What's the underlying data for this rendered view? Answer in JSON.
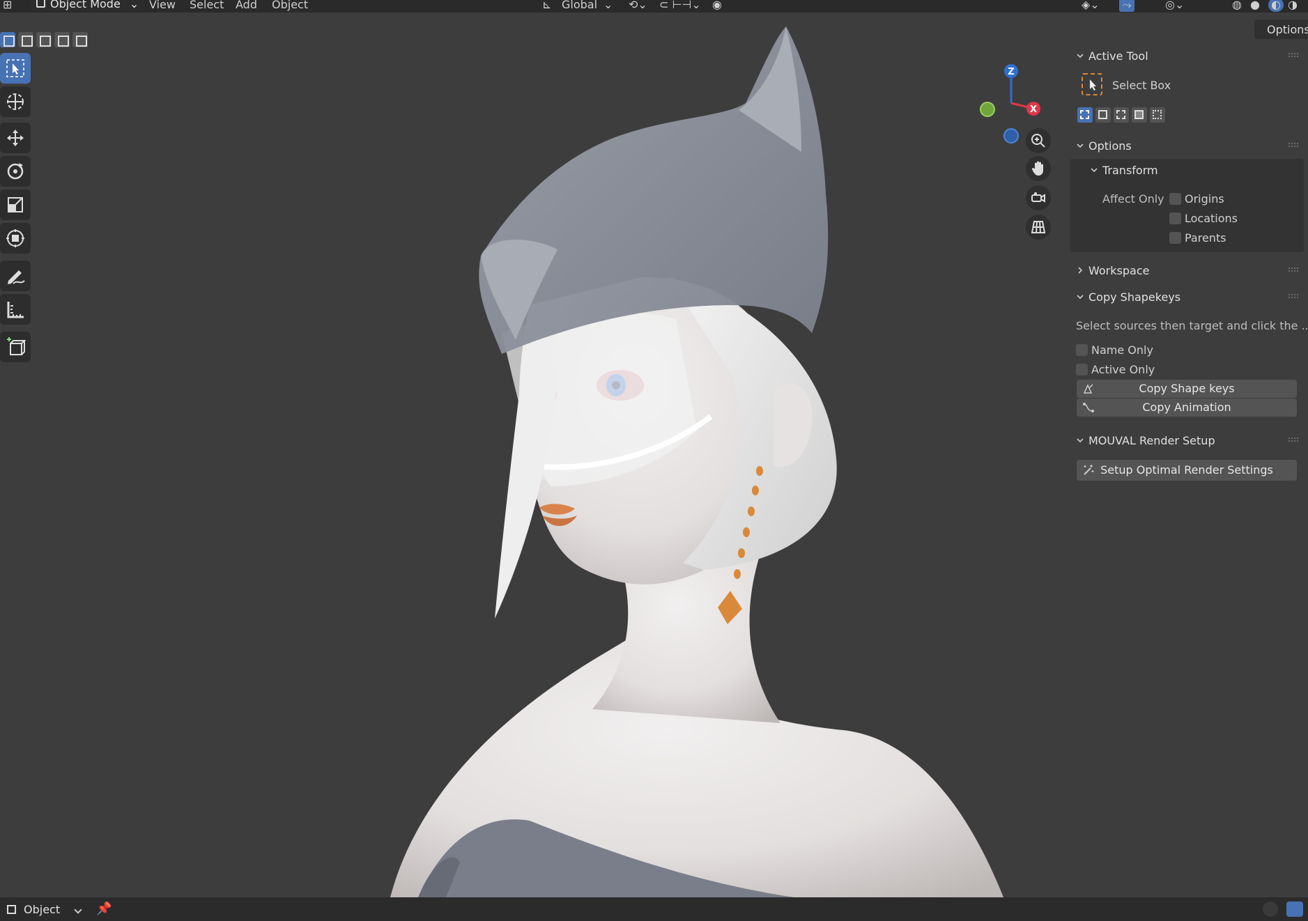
{
  "header": {
    "mode": "Object Mode",
    "menus": [
      "View",
      "Select",
      "Add",
      "Object"
    ],
    "orientation": "Global"
  },
  "options_tab": "Options",
  "toolbar": {
    "tools": [
      "select-box",
      "cursor",
      "move",
      "rotate",
      "scale",
      "transform",
      "annotate",
      "measure",
      "add-cube"
    ],
    "active_tool": "select-box"
  },
  "gizmo": {
    "axes": [
      "Z",
      "X"
    ],
    "colors": {
      "z": "#2f6fd0",
      "x": "#e0364a",
      "y": "#6fa53a"
    }
  },
  "panel": {
    "active_tool": {
      "title": "Active Tool",
      "tool_name": "Select Box"
    },
    "options": {
      "title": "Options",
      "transform": {
        "title": "Transform",
        "affect_only": "Affect Only",
        "items": [
          {
            "label": "Origins",
            "checked": false
          },
          {
            "label": "Locations",
            "checked": false
          },
          {
            "label": "Parents",
            "checked": false
          }
        ]
      }
    },
    "workspace": {
      "title": "Workspace"
    },
    "copy_shapekeys": {
      "title": "Copy Shapekeys",
      "hint": "Select sources then target and click the ...",
      "name_only": "Name Only",
      "active_only": "Active Only",
      "copy_shape_keys": "Copy Shape keys",
      "copy_animation": "Copy Animation"
    },
    "mouval": {
      "title": "MOUVAL Render Setup",
      "setup_button": "Setup Optimal Render Settings"
    }
  },
  "statusbar": {
    "mode": "Object"
  },
  "colors": {
    "accent": "#4772b3",
    "viewport_bg": "#3d3d3d",
    "orange": "#d88a3a"
  }
}
